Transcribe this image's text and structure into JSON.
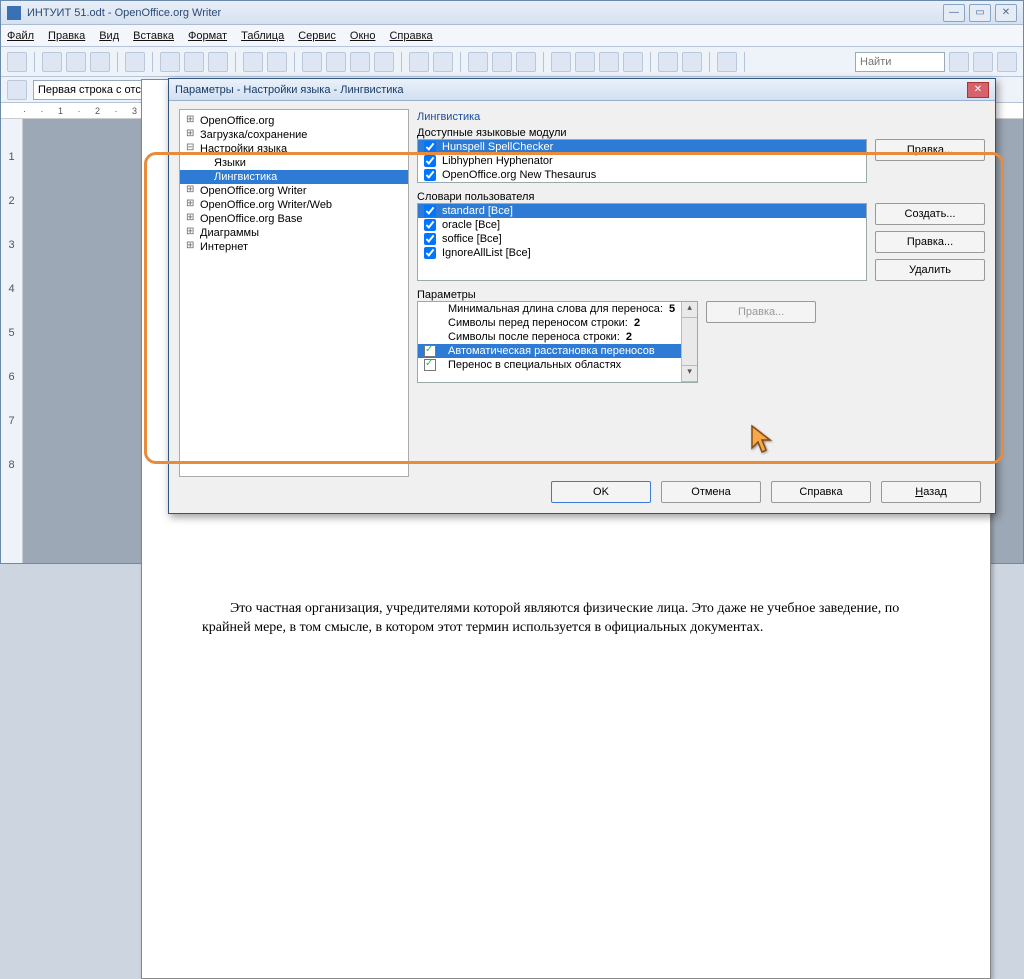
{
  "app": {
    "title": "ИНТУИТ 51.odt - OpenOffice.org Writer"
  },
  "menu": {
    "file": "Файл",
    "edit": "Правка",
    "view": "Вид",
    "insert": "Вставка",
    "format": "Формат",
    "table": "Таблица",
    "tools": "Сервис",
    "window": "Окно",
    "help": "Справка"
  },
  "toolbar": {
    "find_placeholder": "Найти"
  },
  "secondbar": {
    "para_style": "Первая строка с отс"
  },
  "doc": {
    "para": "Это частная организация, учредителями которой являются физические лица. Это даже не учебное заведение, по крайней мере, в том смысле, в котором этот термин используется в официальных документах."
  },
  "dialog": {
    "title": "Параметры - Настройки языка - Лингвистика",
    "tree": {
      "n0": "OpenOffice.org",
      "n1": "Загрузка/сохранение",
      "n2": "Настройки языка",
      "n2a": "Языки",
      "n2b": "Лингвистика",
      "n3": "OpenOffice.org Writer",
      "n4": "OpenOffice.org Writer/Web",
      "n5": "OpenOffice.org Base",
      "n6": "Диаграммы",
      "n7": "Интернет"
    },
    "headers": {
      "h0": "Лингвистика",
      "h1": "Доступные языковые модули",
      "h2": "Словари пользователя",
      "h3": "Параметры"
    },
    "modules": {
      "m0": "Hunspell SpellChecker",
      "m1": "Libhyphen Hyphenator",
      "m2": "OpenOffice.org New Thesaurus"
    },
    "dicts": {
      "d0": "standard [Все]",
      "d1": "oracle [Все]",
      "d2": "soffice [Все]",
      "d3": "IgnoreAllList [Все]"
    },
    "params": {
      "p0_label": "Минимальная длина слова для переноса:",
      "p0_val": "5",
      "p1_label": "Символы перед переносом строки:",
      "p1_val": "2",
      "p2_label": "Символы после переноса строки:",
      "p2_val": "2",
      "p3": "Автоматическая расстановка переносов",
      "p4": "Перенос в специальных областях"
    },
    "buttons": {
      "edit": "Правка...",
      "new": "Создать...",
      "delete": "Удалить",
      "ok": "OK",
      "cancel": "Отмена",
      "help": "Справка",
      "back": "Назад"
    }
  }
}
